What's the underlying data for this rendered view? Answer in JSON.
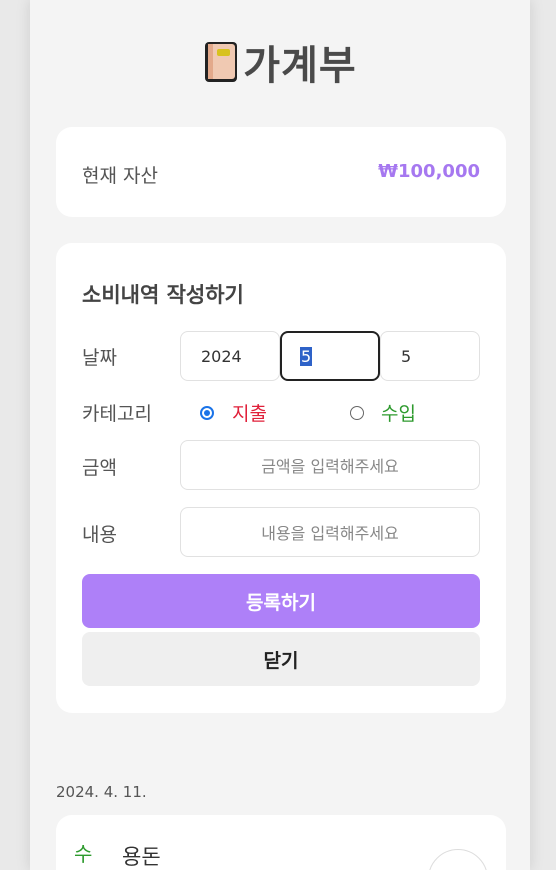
{
  "header": {
    "title": "가계부",
    "icon": "book-icon"
  },
  "asset": {
    "label": "현재 자산",
    "value": "₩100,000"
  },
  "form": {
    "title": "소비내역 작성하기",
    "date_label": "날짜",
    "year": "2024",
    "month": "5",
    "day": "5",
    "category_label": "카테고리",
    "category_options": [
      {
        "label": "지출",
        "selected": true,
        "color": "#e0203a"
      },
      {
        "label": "수입",
        "selected": false,
        "color": "#2e9a2e"
      }
    ],
    "amount_label": "금액",
    "amount_placeholder": "금액을 입력해주세요",
    "content_label": "내용",
    "content_placeholder": "내용을 입력해주세요",
    "submit_label": "등록하기",
    "close_label": "닫기"
  },
  "history": {
    "date": "2024. 4. 11.",
    "entries": [
      {
        "type": "수입",
        "description": "용돈"
      }
    ]
  },
  "colors": {
    "accent": "#ae80f8",
    "asset_value": "#a678f0",
    "expense": "#e0203a",
    "income": "#2e9a2e"
  }
}
